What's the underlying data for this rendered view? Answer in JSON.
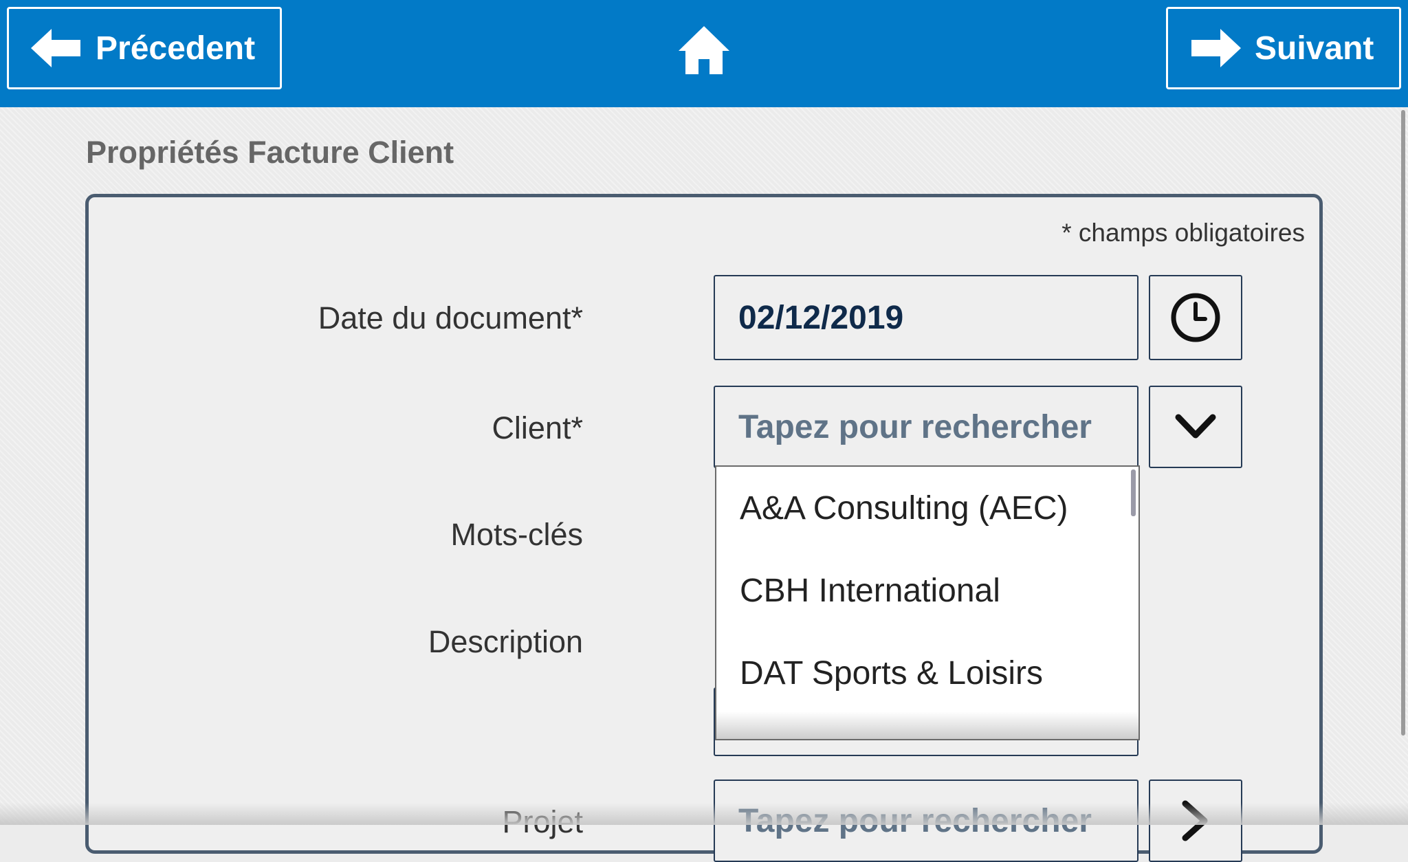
{
  "header": {
    "prev_label": "Précedent",
    "next_label": "Suivant",
    "background": "#027ac7"
  },
  "page": {
    "title": "Propriétés Facture Client",
    "required_note": "* champs obligatoires"
  },
  "form": {
    "date_label": "Date du document*",
    "date_value": "02/12/2019",
    "client_label": "Client*",
    "client_placeholder": "Tapez pour rechercher",
    "keywords_label": "Mots-clés",
    "description_label": "Description",
    "project_label": "Projet",
    "project_placeholder": "Tapez pour rechercher"
  },
  "client_dropdown": {
    "items": [
      "A&A Consulting (AEC)",
      "CBH International",
      "DAT Sports & Loisirs"
    ]
  },
  "icons": {
    "prev": "arrow-left-icon",
    "next": "arrow-right-icon",
    "home": "home-icon",
    "clock": "clock-icon",
    "dropdown": "chevron-down-icon"
  }
}
